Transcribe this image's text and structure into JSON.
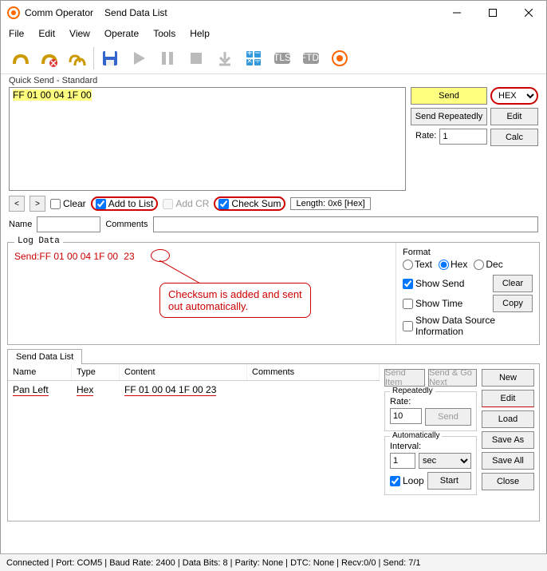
{
  "window": {
    "app": "Comm Operator",
    "sub": "Send Data List"
  },
  "menu": [
    "File",
    "Edit",
    "View",
    "Operate",
    "Tools",
    "Help"
  ],
  "quick_send": {
    "label": "Quick Send - Standard",
    "hex": "FF 01 00 04 1F 00",
    "send": "Send",
    "repeat": "Send Repeatedly",
    "edit": "Edit",
    "calc": "Calc",
    "rate": "Rate:",
    "rate_val": "1",
    "format": "HEX",
    "clear": "Clear",
    "addlist": "Add to List",
    "addcr": "Add CR",
    "checksum": "Check Sum",
    "length": "Length: 0x6 [Hex]",
    "name": "Name",
    "comments": "Comments"
  },
  "log": {
    "title": "Log Data",
    "line_prefix": "Send:",
    "line_data": "FF 01 00 04 1F 00",
    "checksum": "23",
    "callout": "Checksum is added and sent out automatically.",
    "format_label": "Format",
    "fmt_text": "Text",
    "fmt_hex": "Hex",
    "fmt_dec": "Dec",
    "show_send": "Show Send",
    "show_time": "Show Time",
    "show_src": "Show Data Source Information",
    "clear": "Clear",
    "copy": "Copy"
  },
  "sendlist": {
    "tab": "Send Data List",
    "cols": {
      "name": "Name",
      "type": "Type",
      "content": "Content",
      "comments": "Comments"
    },
    "row": {
      "name": "Pan Left",
      "type": "Hex",
      "content": "FF 01 00 04 1F 00 23",
      "comments": ""
    },
    "send_item": "Send Item",
    "send_go": "Send & Go Next",
    "grp_rep": "Repeatedly",
    "rate": "Rate:",
    "rate_val": "10",
    "send": "Send",
    "grp_auto": "Automatically",
    "interval": "Interval:",
    "int_val": "1",
    "int_unit": "sec",
    "loop": "Loop",
    "start": "Start",
    "btns": {
      "new": "New",
      "edit": "Edit",
      "load": "Load",
      "saveas": "Save As",
      "saveall": "Save All",
      "close": "Close"
    }
  },
  "status": "Connected | Port: COM5 | Baud Rate: 2400 | Data Bits: 8 | Parity: None | DTC: None | Recv:0/0 | Send: 7/1"
}
